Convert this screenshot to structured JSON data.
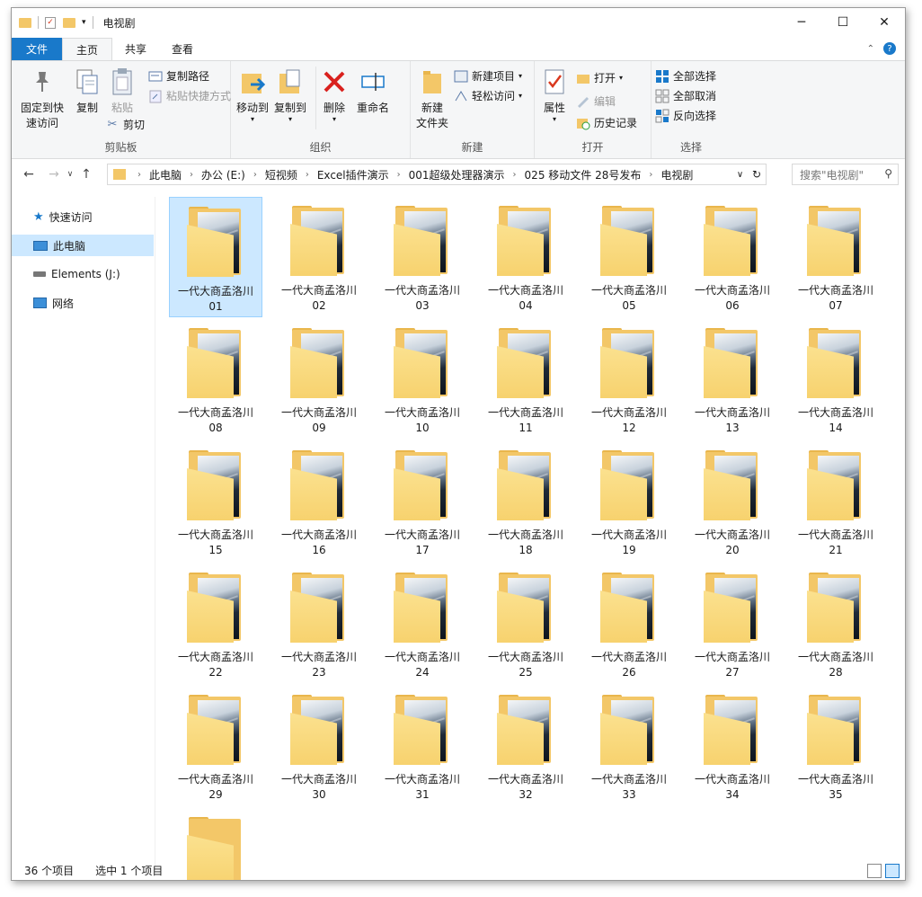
{
  "window": {
    "title": "电视剧",
    "controls": {
      "minimize": "─",
      "maximize": "☐",
      "close": "✕"
    }
  },
  "ribbon_tabs": [
    {
      "label": "文件"
    },
    {
      "label": "主页"
    },
    {
      "label": "共享"
    },
    {
      "label": "查看"
    }
  ],
  "ribbon": {
    "clipboard": {
      "group_label": "剪贴板",
      "pin": "固定到快\n速访问",
      "copy": "复制",
      "paste": "粘贴",
      "copy_path": "复制路径",
      "paste_shortcut": "粘贴快捷方式",
      "cut": "剪切"
    },
    "organize": {
      "group_label": "组织",
      "move_to": "移动到",
      "copy_to": "复制到",
      "delete": "删除",
      "rename": "重命名"
    },
    "new": {
      "group_label": "新建",
      "new_folder": "新建\n文件夹",
      "new_item": "新建项目",
      "easy_access": "轻松访问"
    },
    "open": {
      "group_label": "打开",
      "properties": "属性",
      "open": "打开",
      "edit": "编辑",
      "history": "历史记录"
    },
    "select": {
      "group_label": "选择",
      "select_all": "全部选择",
      "select_none": "全部取消",
      "invert": "反向选择"
    }
  },
  "address": {
    "crumbs": [
      "此电脑",
      "办公 (E:)",
      "短视频",
      "Excel插件演示",
      "001超级处理器演示",
      "025 移动文件 28号发布",
      "电视剧"
    ],
    "search_placeholder": "搜索\"电视剧\""
  },
  "navpane": [
    {
      "label": "快速访问"
    },
    {
      "label": "此电脑"
    },
    {
      "label": "Elements (J:)"
    },
    {
      "label": "网络"
    }
  ],
  "folders": [
    {
      "name": "一代大商孟洛川",
      "num": "01"
    },
    {
      "name": "一代大商孟洛川",
      "num": "02"
    },
    {
      "name": "一代大商孟洛川",
      "num": "03"
    },
    {
      "name": "一代大商孟洛川",
      "num": "04"
    },
    {
      "name": "一代大商孟洛川",
      "num": "05"
    },
    {
      "name": "一代大商孟洛川",
      "num": "06"
    },
    {
      "name": "一代大商孟洛川",
      "num": "07"
    },
    {
      "name": "一代大商孟洛川",
      "num": "08"
    },
    {
      "name": "一代大商孟洛川",
      "num": "09"
    },
    {
      "name": "一代大商孟洛川",
      "num": "10"
    },
    {
      "name": "一代大商孟洛川",
      "num": "11"
    },
    {
      "name": "一代大商孟洛川",
      "num": "12"
    },
    {
      "name": "一代大商孟洛川",
      "num": "13"
    },
    {
      "name": "一代大商孟洛川",
      "num": "14"
    },
    {
      "name": "一代大商孟洛川",
      "num": "15"
    },
    {
      "name": "一代大商孟洛川",
      "num": "16"
    },
    {
      "name": "一代大商孟洛川",
      "num": "17"
    },
    {
      "name": "一代大商孟洛川",
      "num": "18"
    },
    {
      "name": "一代大商孟洛川",
      "num": "19"
    },
    {
      "name": "一代大商孟洛川",
      "num": "20"
    },
    {
      "name": "一代大商孟洛川",
      "num": "21"
    },
    {
      "name": "一代大商孟洛川",
      "num": "22"
    },
    {
      "name": "一代大商孟洛川",
      "num": "23"
    },
    {
      "name": "一代大商孟洛川",
      "num": "24"
    },
    {
      "name": "一代大商孟洛川",
      "num": "25"
    },
    {
      "name": "一代大商孟洛川",
      "num": "26"
    },
    {
      "name": "一代大商孟洛川",
      "num": "27"
    },
    {
      "name": "一代大商孟洛川",
      "num": "28"
    },
    {
      "name": "一代大商孟洛川",
      "num": "29"
    },
    {
      "name": "一代大商孟洛川",
      "num": "30"
    },
    {
      "name": "一代大商孟洛川",
      "num": "31"
    },
    {
      "name": "一代大商孟洛川",
      "num": "32"
    },
    {
      "name": "一代大商孟洛川",
      "num": "33"
    },
    {
      "name": "一代大商孟洛川",
      "num": "34"
    },
    {
      "name": "一代大商孟洛川",
      "num": "35"
    }
  ],
  "status": {
    "count": "36 个项目",
    "selected": "选中 1 个项目"
  },
  "colors": {
    "accent": "#1979ca",
    "selection": "#cce8ff",
    "folder": "#f7d26e"
  }
}
